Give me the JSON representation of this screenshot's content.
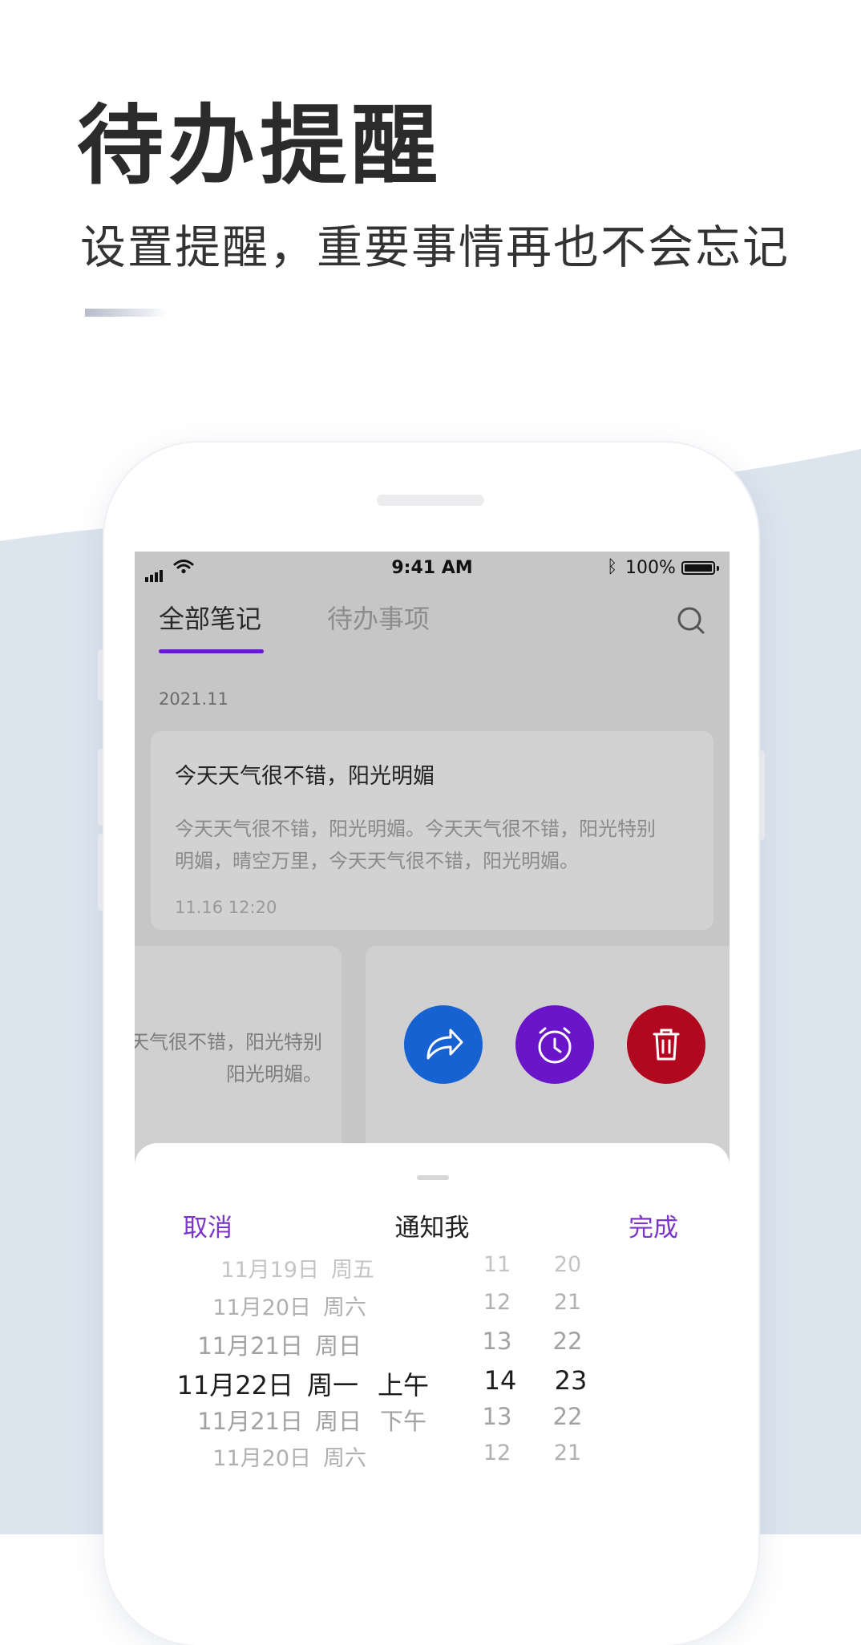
{
  "headline": "待办提醒",
  "subheadline": "设置提醒，重要事情再也不会忘记",
  "status_bar": {
    "time": "9:41 AM",
    "battery": "100%"
  },
  "tabs": [
    {
      "label": "全部笔记",
      "active": true
    },
    {
      "label": "待办事项",
      "active": false
    }
  ],
  "date_group": "2021.11",
  "note": {
    "title": "今天天气很不错，阳光明媚",
    "body_line1": "今天天气很不错，阳光明媚。今天天气很不错，阳光特别",
    "body_line2": "明媚，晴空万里，今天天气很不错，阳光明媚。",
    "time": "11.16  12:20"
  },
  "partial_card": {
    "line1": "天气很不错，阳光特别",
    "line2": "阳光明媚。"
  },
  "actions": [
    {
      "name": "share",
      "color": "#1662d3"
    },
    {
      "name": "alarm",
      "color": "#6a15c9"
    },
    {
      "name": "delete",
      "color": "#b1071f"
    }
  ],
  "sheet": {
    "cancel": "取消",
    "title": "通知我",
    "done": "完成"
  },
  "picker": {
    "rows": [
      {
        "date": "11月19日",
        "weekday": "周五",
        "ampm": "",
        "hour": "11",
        "minute": "20"
      },
      {
        "date": "11月20日",
        "weekday": "周六",
        "ampm": "",
        "hour": "12",
        "minute": "21"
      },
      {
        "date": "11月21日",
        "weekday": "周日",
        "ampm": "",
        "hour": "13",
        "minute": "22"
      },
      {
        "date": "11月22日",
        "weekday": "周一",
        "ampm": "上午",
        "hour": "14",
        "minute": "23"
      },
      {
        "date": "11月21日",
        "weekday": "周日",
        "ampm": "下午",
        "hour": "13",
        "minute": "22"
      },
      {
        "date": "11月20日",
        "weekday": "周六",
        "ampm": "",
        "hour": "12",
        "minute": "21"
      }
    ],
    "selected_index": 3
  },
  "colors": {
    "accent": "#6a19c8",
    "background_wave": "#dce4ee"
  }
}
